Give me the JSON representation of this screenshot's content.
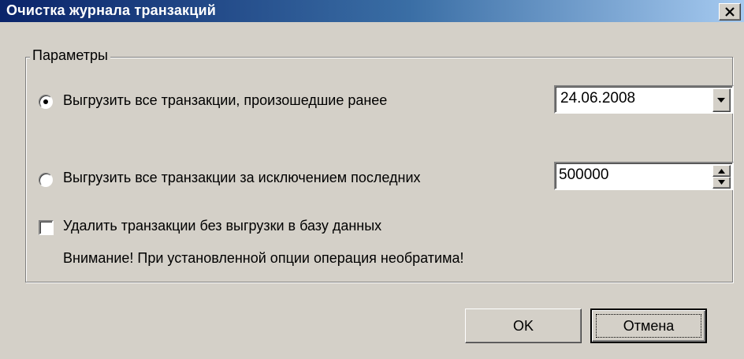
{
  "dialog": {
    "title": "Очистка журнала транзакций"
  },
  "parameters": {
    "group_label": "Параметры",
    "option_before_date": {
      "label": "Выгрузить все транзакции, произошедшие ранее",
      "selected": true,
      "date_value": "24.06.2008"
    },
    "option_except_last": {
      "label": "Выгрузить все транзакции за исключением последних",
      "selected": false,
      "count_value": "500000"
    },
    "delete_without_export": {
      "label": "Удалить транзакции без выгрузки в базу данных",
      "checked": false
    },
    "warning": "Внимание! При установленной опции операция необратима!"
  },
  "buttons": {
    "ok_label": "OK",
    "cancel_label": "Отмена"
  },
  "icons": {
    "close": "close-icon",
    "dropdown": "chevron-down-icon",
    "spin_up": "arrow-up-icon",
    "spin_down": "arrow-down-icon"
  },
  "colors": {
    "title_gradient_start": "#0a246a",
    "title_gradient_end": "#a6caf0",
    "dialog_background": "#d4d0c8"
  }
}
